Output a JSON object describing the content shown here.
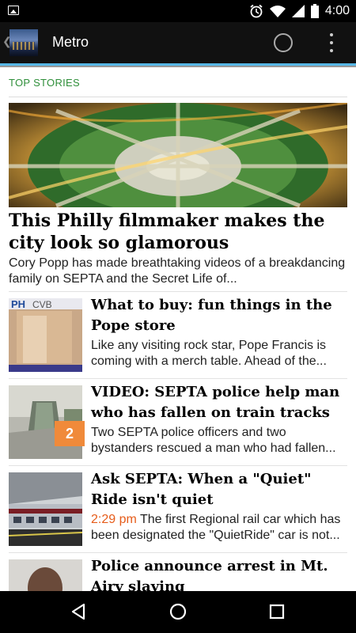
{
  "status_bar": {
    "time": "4:00",
    "icons": [
      "image-icon",
      "alarm-icon",
      "wifi-icon",
      "signal-icon",
      "battery-icon"
    ]
  },
  "action_bar": {
    "title": "Metro",
    "icons": [
      "back-chevron-icon",
      "loading-spinner-icon",
      "overflow-menu-icon"
    ]
  },
  "section": {
    "label": "TOP STORIES"
  },
  "hero": {
    "title": "This Philly filmmaker makes the city look so glamorous",
    "summary": "Cory Popp has made breathtaking videos of a breakdancing family on SEPTA and the Secret Life of..."
  },
  "stories": [
    {
      "headline": "What to buy: fun things in the Pope store",
      "summary": "Like any visiting rock star, Pope Francis is coming with a merch table.  Ahead of the..."
    },
    {
      "headline": "VIDEO: SEPTA police help man who has fallen on train tracks",
      "summary": "Two SEPTA police officers and two bystanders rescued a man who had fallen...",
      "badge": "2"
    },
    {
      "headline": "Ask SEPTA: When a \"Quiet\" Ride isn't quiet",
      "timestamp": "2:29 pm",
      "summary": " The first Regional rail car which has been designated the \"QuietRide\" car is not..."
    },
    {
      "headline": "Police announce arrest in Mt. Airy slaying",
      "summary": ""
    }
  ],
  "nav_bar": {
    "icons": [
      "back-triangle-icon",
      "home-circle-icon",
      "recents-square-icon"
    ]
  },
  "colors": {
    "accent": "#56b7e6",
    "section_label": "#2f8f3a",
    "timestamp": "#e65c1a",
    "badge": "#f08a3a"
  }
}
